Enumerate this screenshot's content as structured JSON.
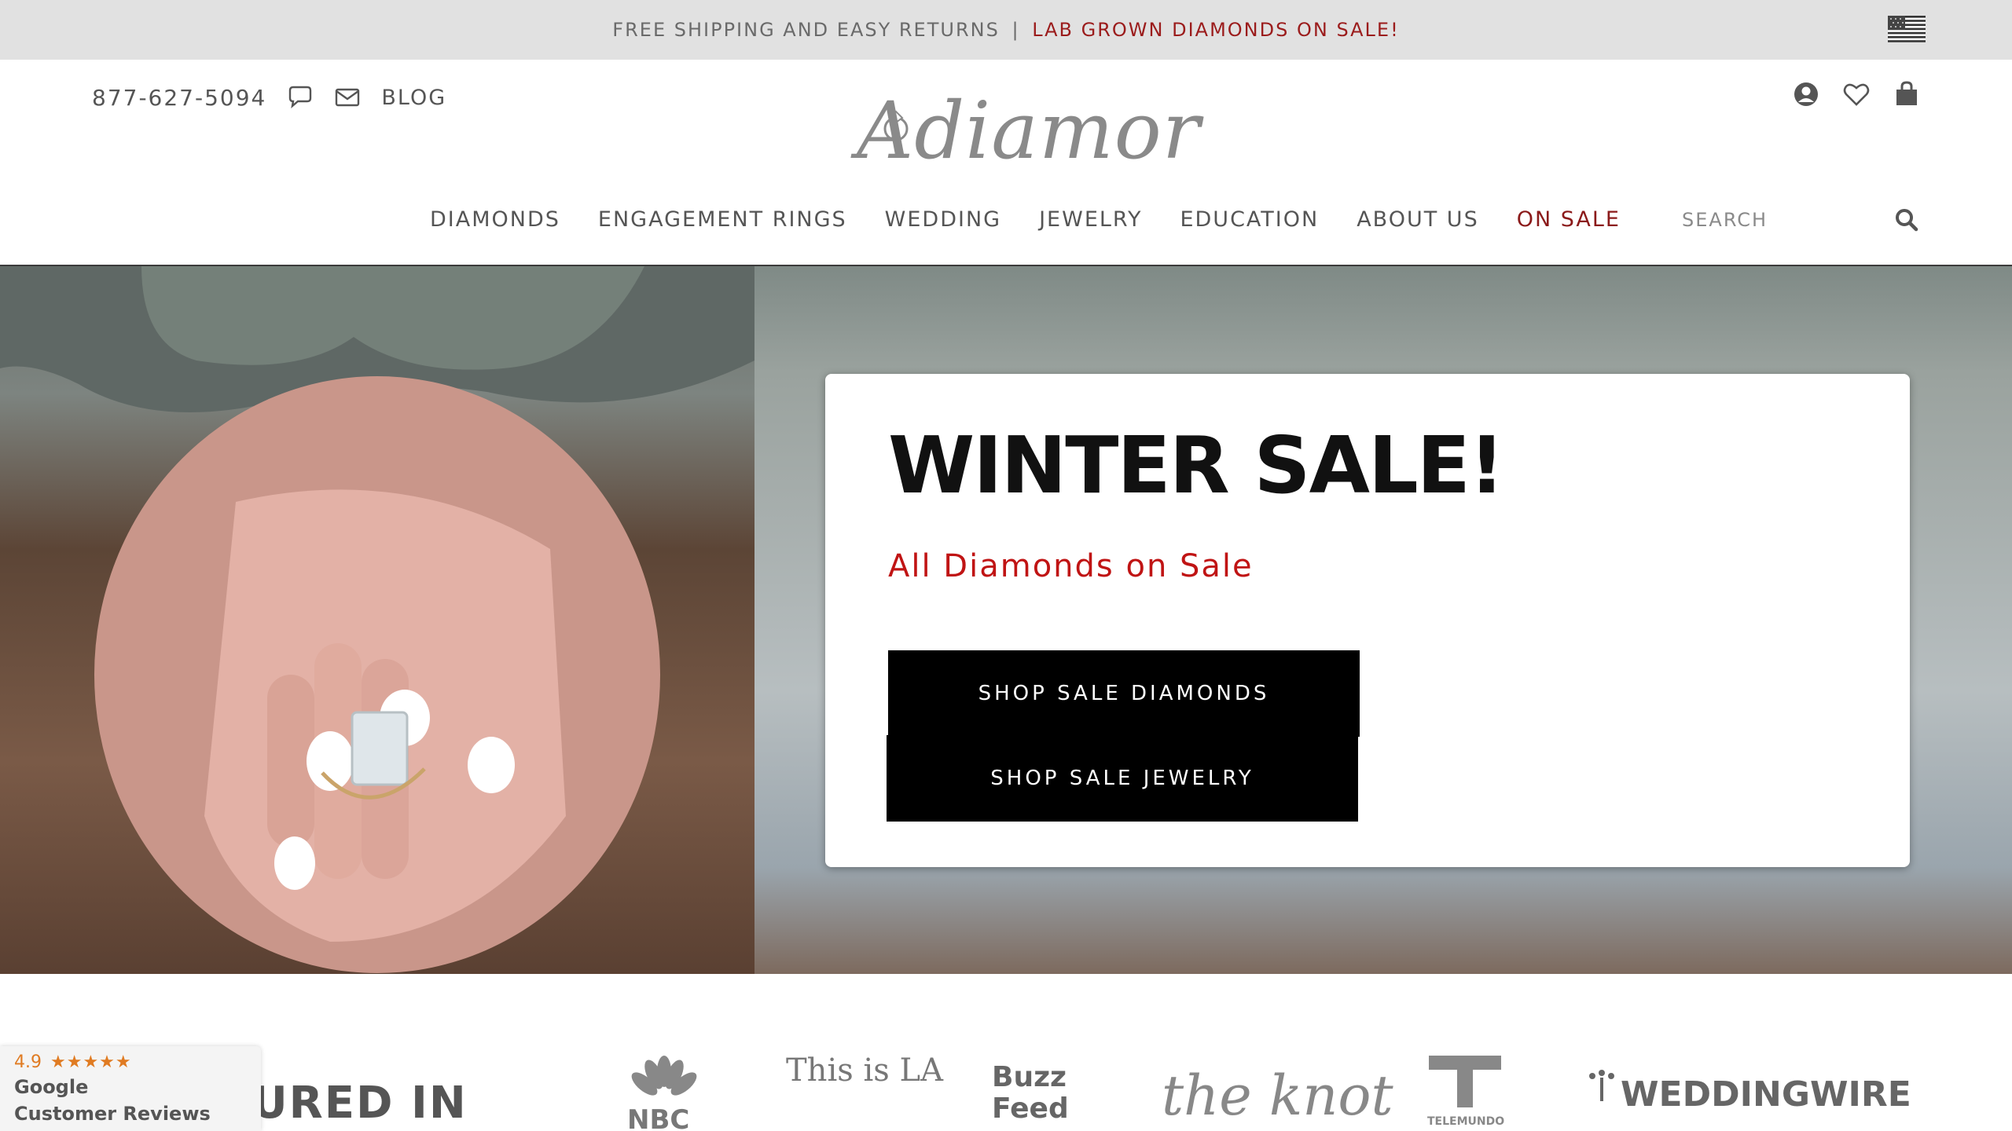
{
  "promo": {
    "text": "FREE SHIPPING AND EASY RETURNS",
    "separator": "|",
    "link": "LAB GROWN DIAMONDS ON SALE!",
    "flag_icon": "us-flag-icon"
  },
  "header": {
    "phone": "877-627-5094",
    "blog": "BLOG",
    "logo_text": "Adiamor",
    "icons": [
      "chat-icon",
      "mail-icon",
      "account-icon",
      "heart-icon",
      "shopping-bag-icon"
    ]
  },
  "nav": {
    "items": [
      "DIAMONDS",
      "ENGAGEMENT RINGS",
      "WEDDING",
      "JEWELRY",
      "EDUCATION",
      "ABOUT US",
      "ON SALE"
    ],
    "search_placeholder": "SEARCH"
  },
  "hero": {
    "title": "WINTER SALE!",
    "subtitle": "All Diamonds on Sale",
    "button_diamonds": "SHOP SALE DIAMONDS",
    "button_jewelry": "SHOP SALE JEWELRY"
  },
  "featured": {
    "label": "TURED IN",
    "logos": [
      "NBC",
      "This is LA",
      "Buzz Feed",
      "the knot",
      "TELEMUNDO",
      "WEDDINGWIRE"
    ]
  },
  "google_badge": {
    "rating": "4.9",
    "stars": "★★★★★",
    "brand": "Google",
    "label": "Customer Reviews"
  },
  "colors": {
    "accent_red": "#9b1c1c",
    "sale_red": "#c01414",
    "promo_bg": "#e1e1e1",
    "star_orange": "#e07b22"
  }
}
